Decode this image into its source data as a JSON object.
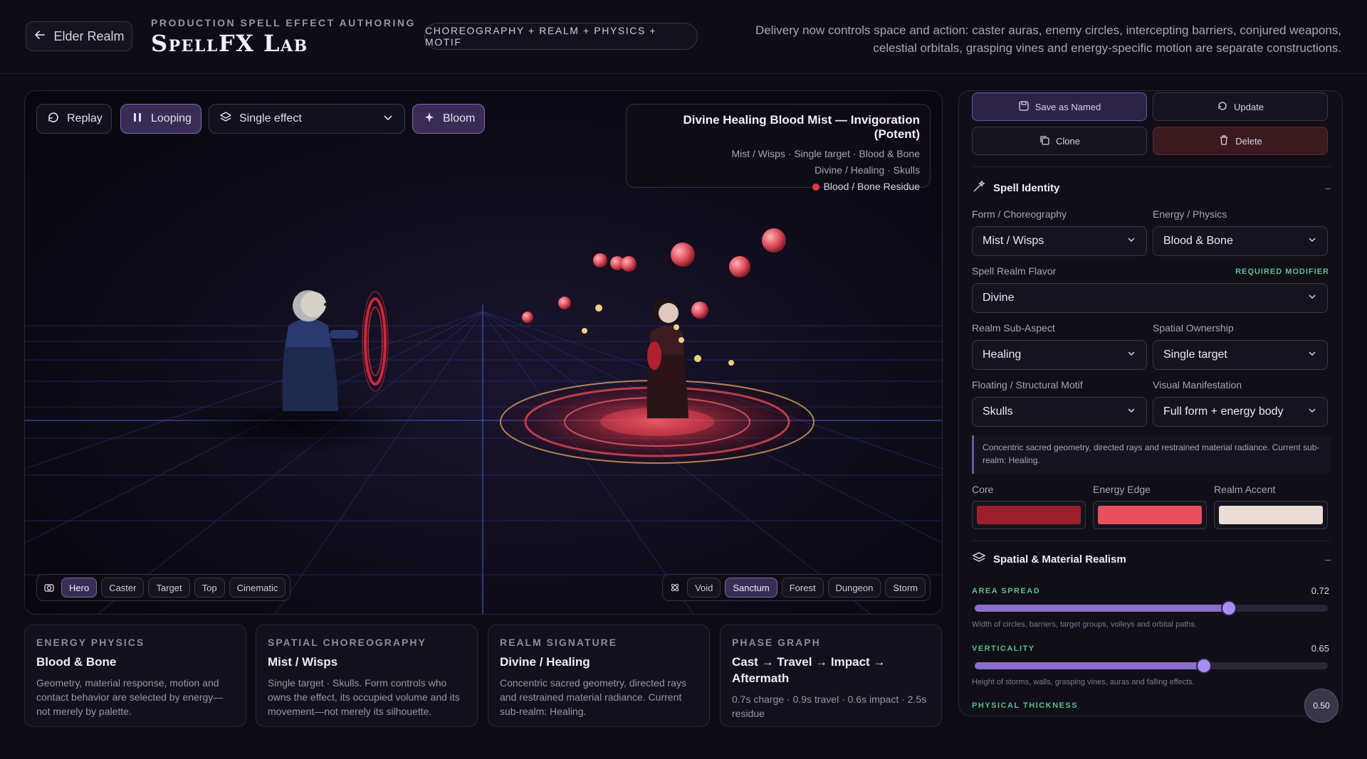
{
  "header": {
    "back_label": "Elder Realm",
    "subtitle": "PRODUCTION SPELL EFFECT AUTHORING",
    "title": "SpellFX Lab",
    "tag": "CHOREOGRAPHY + REALM + PHYSICS + MOTIF",
    "description": "Delivery now controls space and action: caster auras, enemy circles, intercepting barriers, conjured weapons, celestial orbitals, grasping vines and energy-specific motion are separate constructions."
  },
  "viewport": {
    "replay_label": "Replay",
    "looping_label": "Looping",
    "effect_select": "Single effect",
    "bloom_label": "Bloom",
    "info": {
      "title": "Divine Healing Blood Mist — Invigoration (Potent)",
      "line1": "Mist / Wisps · Single target · Blood & Bone",
      "line2": "Divine / Healing · Skulls",
      "residue": "Blood / Bone Residue"
    },
    "cameras": [
      "Hero",
      "Caster",
      "Target",
      "Top",
      "Cinematic"
    ],
    "camera_active": "Hero",
    "environments": [
      "Void",
      "Sanctum",
      "Forest",
      "Dungeon",
      "Storm"
    ],
    "environment_active": "Sanctum"
  },
  "cards": [
    {
      "label": "ENERGY PHYSICS",
      "title": "Blood & Bone",
      "text": "Geometry, material response, motion and contact behavior are selected by energy—not merely by palette."
    },
    {
      "label": "SPATIAL CHOREOGRAPHY",
      "title": "Mist / Wisps",
      "text": "Single target · Skulls. Form controls who owns the effect, its occupied volume and its movement—not merely its silhouette."
    },
    {
      "label": "REALM SIGNATURE",
      "title": "Divine / Healing",
      "text": "Concentric sacred geometry, directed rays and restrained material radiance. Current sub-realm: Healing."
    },
    {
      "label": "PHASE GRAPH",
      "title": "Cast → Travel → Impact → Aftermath",
      "text": "0.7s charge · 0.9s travel · 0.6s impact · 2.5s residue"
    }
  ],
  "panel": {
    "save_label": "Save as Named",
    "update_label": "Update",
    "clone_label": "Clone",
    "delete_label": "Delete",
    "identity": {
      "title": "Spell Identity",
      "collapse": "–",
      "form_label": "Form / Choreography",
      "form_value": "Mist / Wisps",
      "energy_label": "Energy / Physics",
      "energy_value": "Blood & Bone",
      "realm_label": "Spell Realm Flavor",
      "realm_req": "REQUIRED MODIFIER",
      "realm_value": "Divine",
      "subaspect_label": "Realm Sub-Aspect",
      "subaspect_value": "Healing",
      "ownership_label": "Spatial Ownership",
      "ownership_value": "Single target",
      "motif_label": "Floating / Structural Motif",
      "motif_value": "Skulls",
      "manifest_label": "Visual Manifestation",
      "manifest_value": "Full form + energy body",
      "note": "Concentric sacred geometry, directed rays and restrained material radiance. Current sub-realm: Healing.",
      "core_label": "Core",
      "edge_label": "Energy Edge",
      "accent_label": "Realm Accent",
      "core_color": "#9e1f2c",
      "edge_color": "#e8505c",
      "accent_color": "#ecdcd6"
    },
    "realism": {
      "title": "Spatial & Material Realism",
      "collapse": "–",
      "area_label": "AREA SPREAD",
      "area_value": "0.72",
      "area_fraction": 0.72,
      "area_help": "Width of circles, barriers, target groups, volleys and orbital paths.",
      "vert_label": "VERTICALITY",
      "vert_value": "0.65",
      "vert_fraction": 0.65,
      "vert_help": "Height of storms, walls, grasping vines, auras and falling effects.",
      "thick_label": "PHYSICAL THICKNESS",
      "thick_value": "0.50"
    }
  },
  "colors": {
    "accent": "#8a6fd0",
    "green": "#5fbf8f"
  }
}
